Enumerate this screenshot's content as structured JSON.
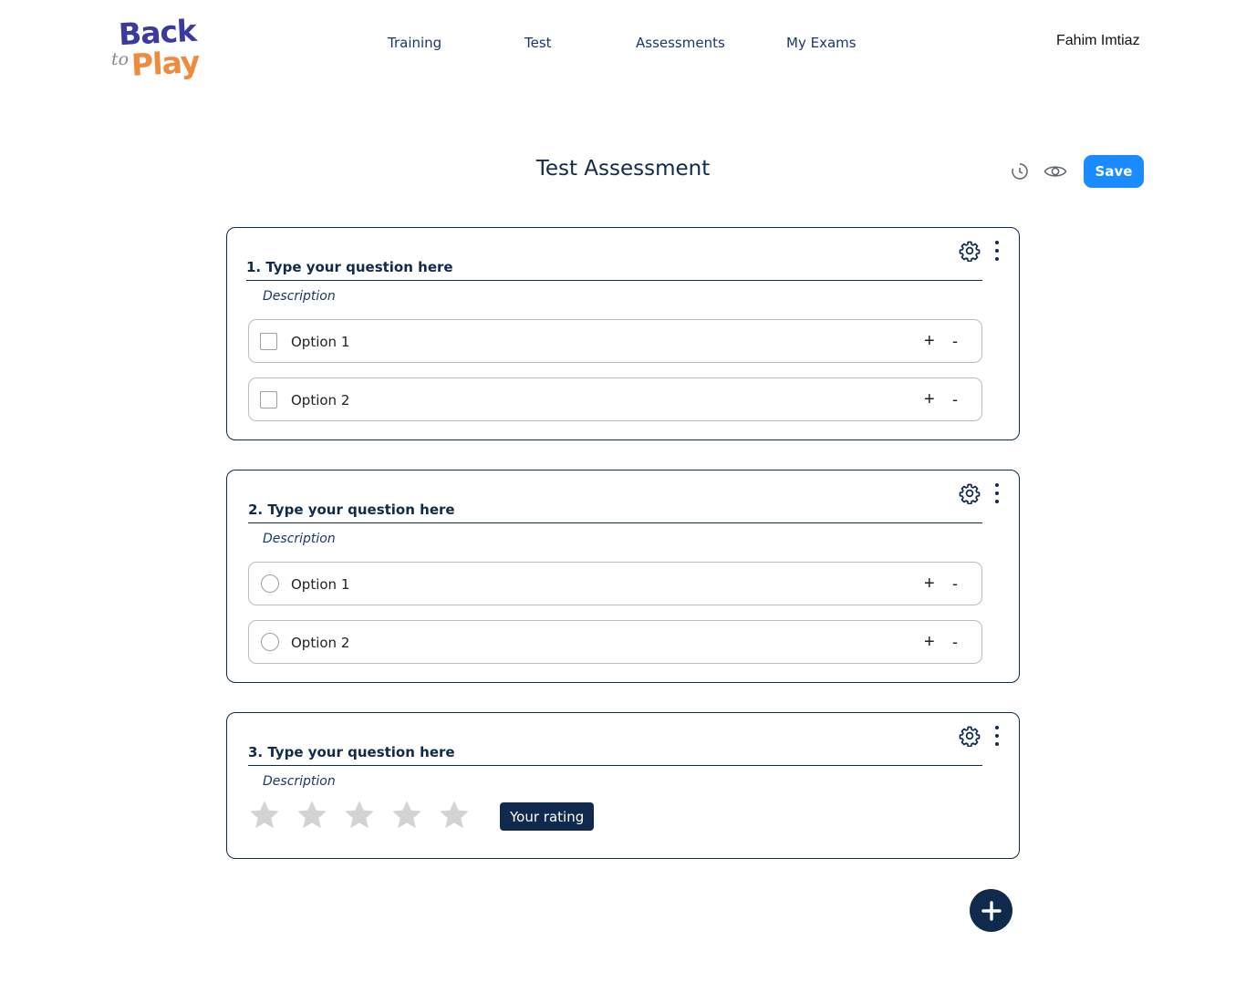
{
  "brand": {
    "logo_line1": "Back",
    "logo_line2_small": "to",
    "logo_line2": "Play"
  },
  "nav": {
    "items": [
      "Training",
      "Test",
      "Assessments",
      "My Exams"
    ]
  },
  "user": {
    "name": "Fahim Imtiaz"
  },
  "page": {
    "title": "Test Assessment",
    "save_label": "Save"
  },
  "icons": {
    "history": "history-icon",
    "preview": "eye-icon",
    "settings": "gear-icon",
    "more": "kebab-menu-icon",
    "add": "add-question-icon",
    "rating": "star-icon"
  },
  "colors": {
    "primary": "#0f2a4d",
    "accent": "#1a8cff",
    "star": "#d3d3d3",
    "brand_purple": "#3c3aa0",
    "brand_orange": "#f08a3c"
  },
  "questions": [
    {
      "title": "1. Type your question here",
      "description": "Description",
      "type": "checkbox",
      "options": [
        "Option 1",
        "Option 2"
      ],
      "add_symbol": "+",
      "remove_symbol": "-"
    },
    {
      "title": "2. Type your question here",
      "description": "Description",
      "type": "radio",
      "options": [
        "Option 1",
        "Option 2"
      ],
      "add_symbol": "+",
      "remove_symbol": "-"
    },
    {
      "title": "3. Type your question here",
      "description": "Description",
      "type": "rating",
      "rating_max": 5,
      "rating_value": 0,
      "rating_label": "Your rating"
    }
  ]
}
